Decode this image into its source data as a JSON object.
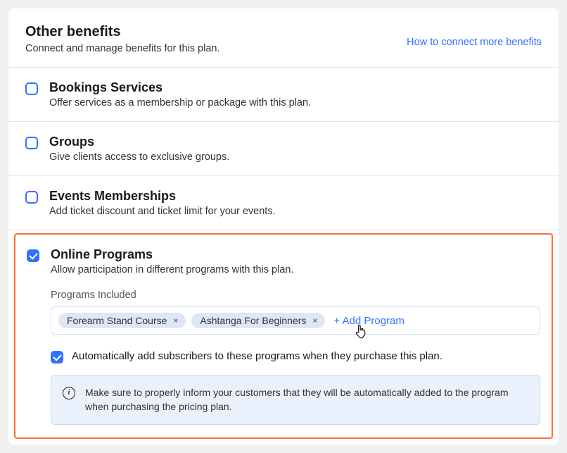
{
  "header": {
    "title": "Other benefits",
    "subtitle": "Connect and manage benefits for this plan.",
    "link": "How to connect more benefits"
  },
  "items": {
    "bookings": {
      "title": "Bookings Services",
      "desc": "Offer services as a membership or package with this plan."
    },
    "groups": {
      "title": "Groups",
      "desc": "Give clients access to exclusive groups."
    },
    "events": {
      "title": "Events Memberships",
      "desc": "Add ticket discount and ticket limit for your events."
    },
    "programs": {
      "title": "Online Programs",
      "desc": "Allow participation in different programs with this plan.",
      "section_label": "Programs Included",
      "chips": {
        "0": "Forearm Stand Course",
        "1": "Ashtanga For Beginners"
      },
      "add_label": "+ Add Program",
      "auto_label": "Automatically add subscribers to these programs when they purchase this plan.",
      "info_text": "Make sure to properly inform your customers that they will be automatically added to the program when purchasing the pricing plan."
    }
  }
}
